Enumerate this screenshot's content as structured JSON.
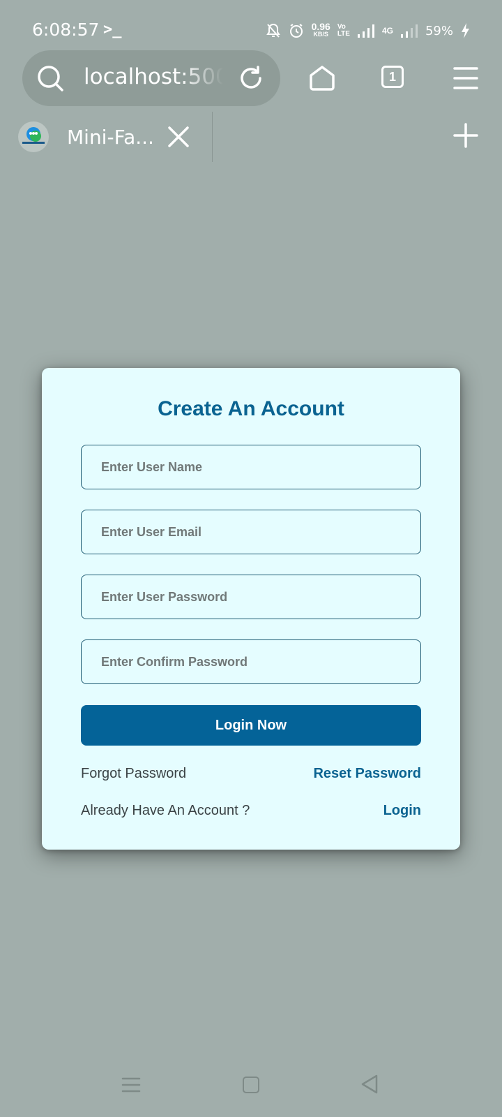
{
  "status_bar": {
    "time": "6:08:57",
    "terminal_glyph": ">_",
    "net_speed": "0.96",
    "net_unit": "KB/S",
    "volte_top": "Vo",
    "volte_bottom": "LTE",
    "network": "4G",
    "battery": "59%"
  },
  "browser": {
    "url": "localhost:5000",
    "tab_count": "1",
    "tab_title": "Mini-Fa..."
  },
  "form": {
    "title": "Create An Account",
    "username_placeholder": "Enter User Name",
    "email_placeholder": "Enter User Email",
    "password_placeholder": "Enter User Password",
    "confirm_placeholder": "Enter Confirm Password",
    "submit_label": "Login Now",
    "forgot_label": "Forgot Password",
    "reset_label": "Reset Password",
    "already_label": "Already Have An Account ?",
    "login_label": "Login"
  },
  "colors": {
    "page_background": "#a1aeab",
    "card_background": "#e5fdff",
    "accent": "#046398",
    "link": "#0b6391"
  }
}
